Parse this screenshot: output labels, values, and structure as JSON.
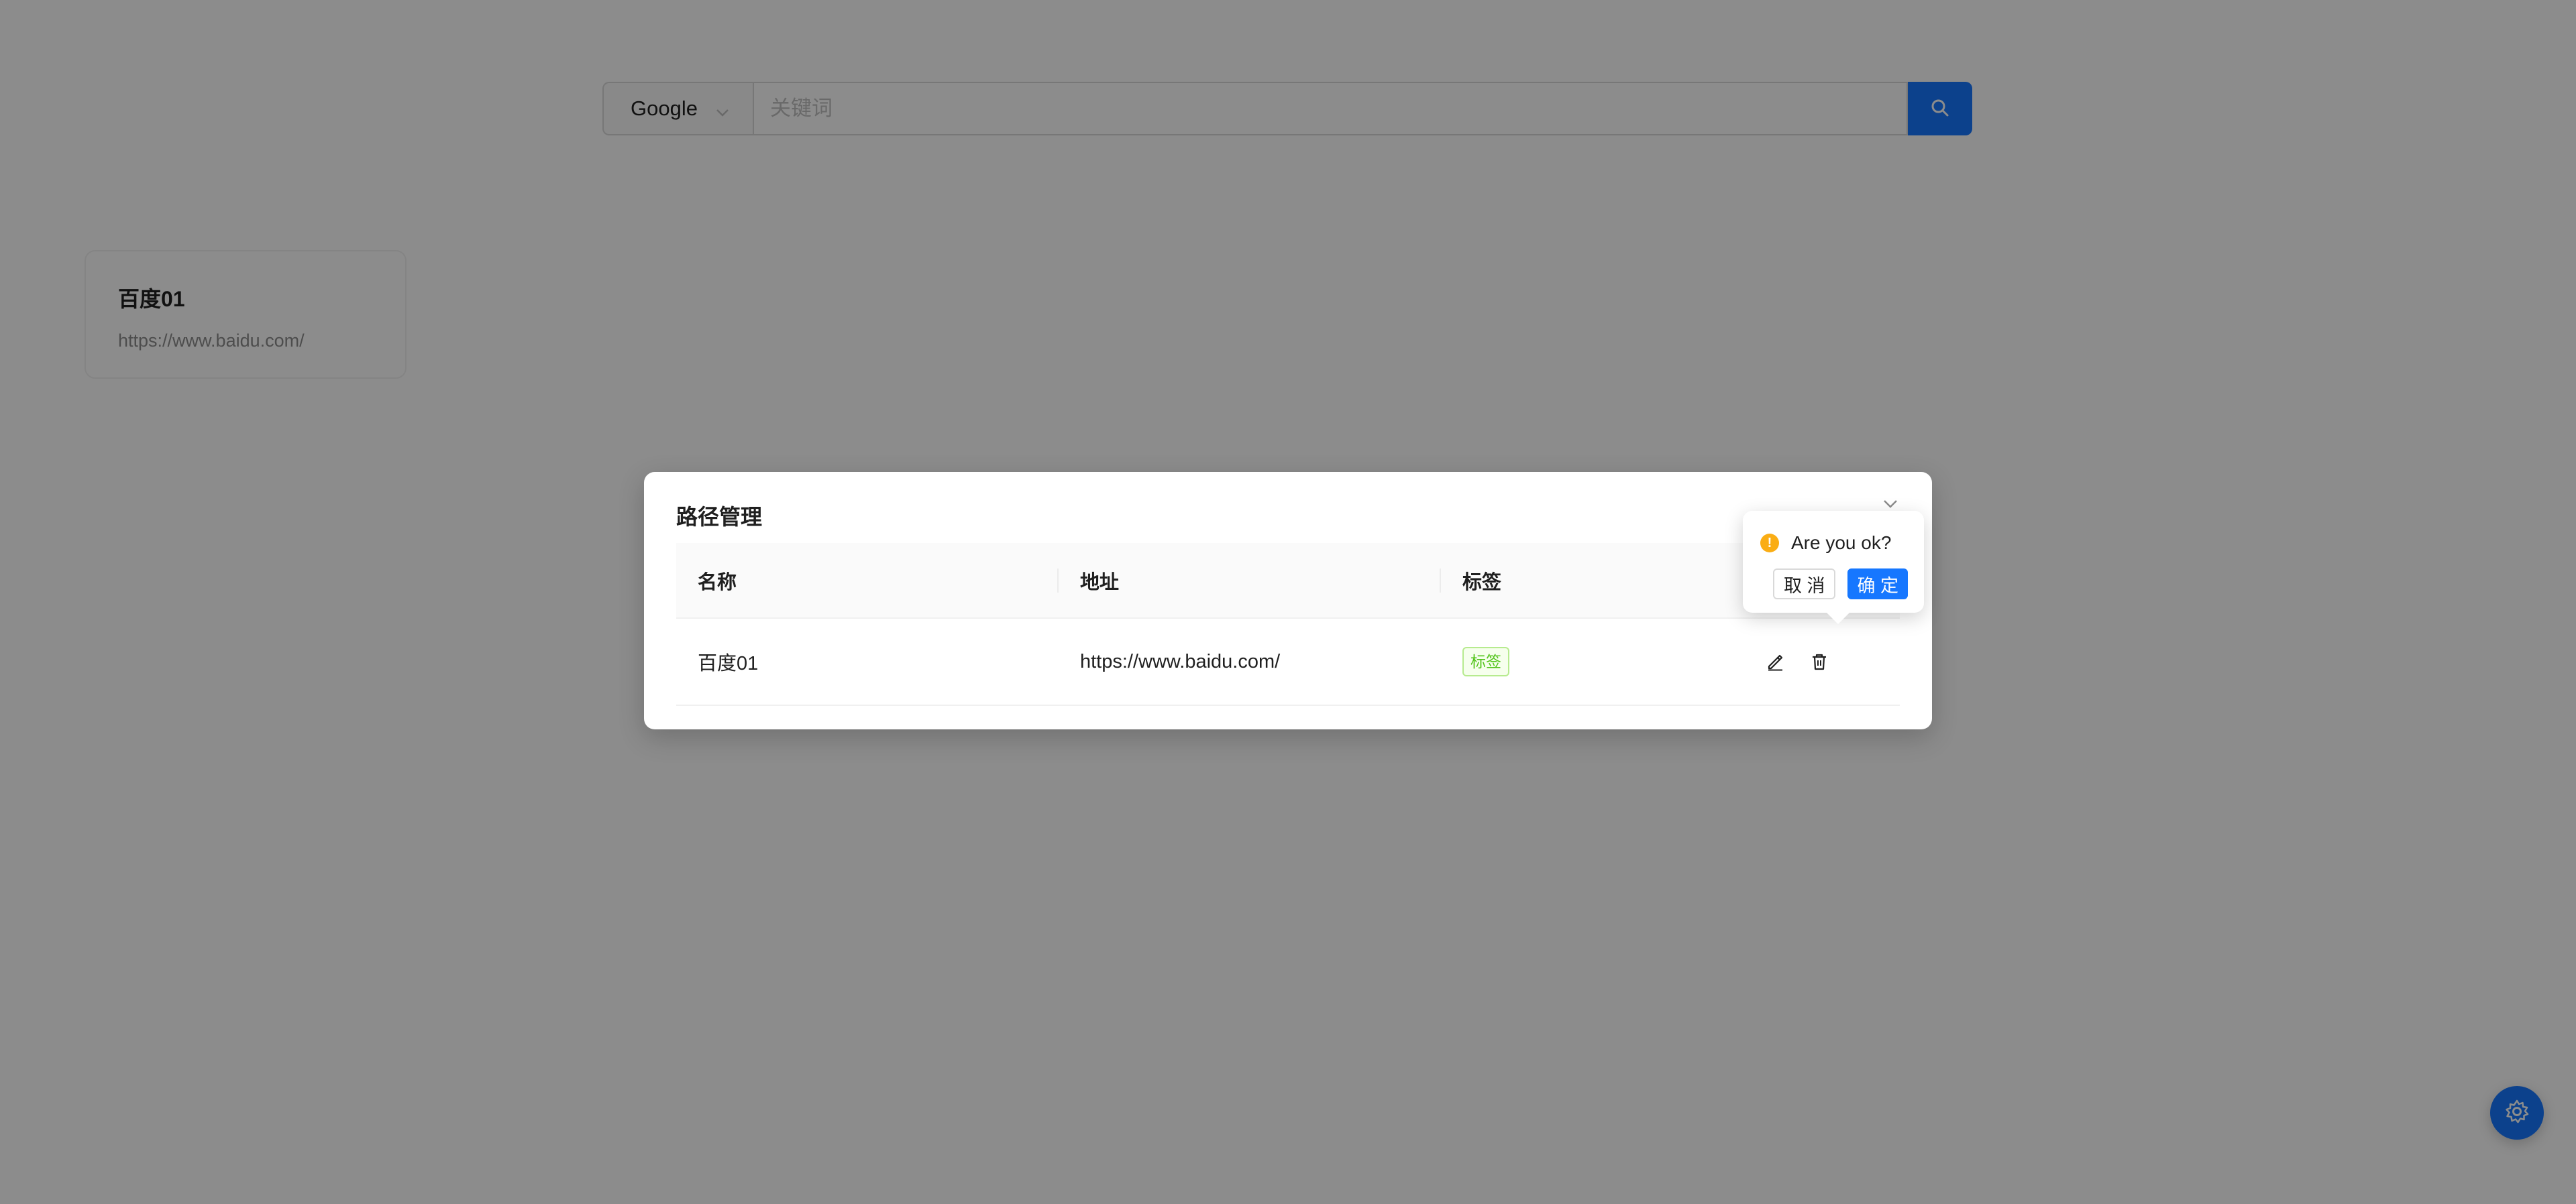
{
  "search": {
    "engine": "Google",
    "placeholder": "关键词",
    "value": ""
  },
  "bookmarks": [
    {
      "title": "百度01",
      "url": "https://www.baidu.com/"
    }
  ],
  "modal": {
    "title": "路径管理",
    "columns": [
      "名称",
      "地址",
      "标签",
      ""
    ],
    "rows": [
      {
        "name": "百度01",
        "url": "https://www.baidu.com/",
        "tag": "标签"
      }
    ]
  },
  "popconfirm": {
    "message": "Are you ok?",
    "cancel_label": "取 消",
    "ok_label": "确 定"
  },
  "icons": {
    "select_chevron": "chevron-down-icon",
    "search": "search-icon",
    "close": "close-icon",
    "edit": "edit-icon",
    "delete": "delete-icon",
    "warning": "warning-icon",
    "settings": "gear-icon"
  },
  "colors": {
    "primary": "#1677ff",
    "tag_green": "#52c41a",
    "warning": "#faad14"
  }
}
